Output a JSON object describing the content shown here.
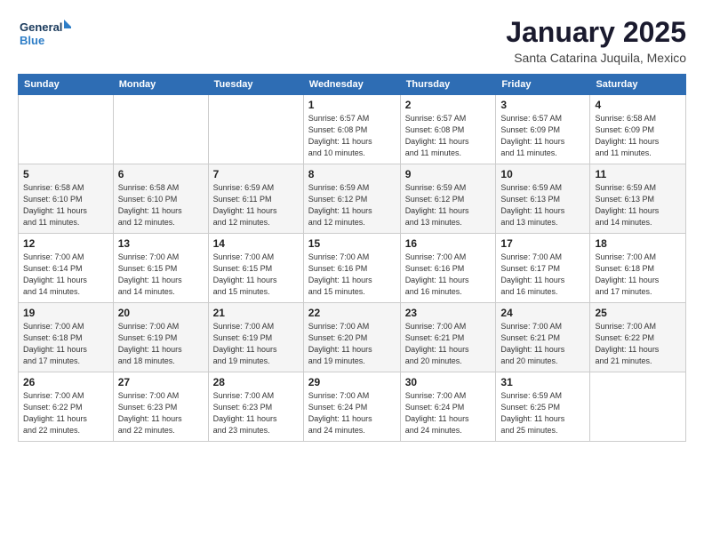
{
  "logo": {
    "line1": "General",
    "line2": "Blue"
  },
  "header": {
    "month": "January 2025",
    "location": "Santa Catarina Juquila, Mexico"
  },
  "weekdays": [
    "Sunday",
    "Monday",
    "Tuesday",
    "Wednesday",
    "Thursday",
    "Friday",
    "Saturday"
  ],
  "weeks": [
    [
      {
        "day": "",
        "info": ""
      },
      {
        "day": "",
        "info": ""
      },
      {
        "day": "",
        "info": ""
      },
      {
        "day": "1",
        "info": "Sunrise: 6:57 AM\nSunset: 6:08 PM\nDaylight: 11 hours\nand 10 minutes."
      },
      {
        "day": "2",
        "info": "Sunrise: 6:57 AM\nSunset: 6:08 PM\nDaylight: 11 hours\nand 11 minutes."
      },
      {
        "day": "3",
        "info": "Sunrise: 6:57 AM\nSunset: 6:09 PM\nDaylight: 11 hours\nand 11 minutes."
      },
      {
        "day": "4",
        "info": "Sunrise: 6:58 AM\nSunset: 6:09 PM\nDaylight: 11 hours\nand 11 minutes."
      }
    ],
    [
      {
        "day": "5",
        "info": "Sunrise: 6:58 AM\nSunset: 6:10 PM\nDaylight: 11 hours\nand 11 minutes."
      },
      {
        "day": "6",
        "info": "Sunrise: 6:58 AM\nSunset: 6:10 PM\nDaylight: 11 hours\nand 12 minutes."
      },
      {
        "day": "7",
        "info": "Sunrise: 6:59 AM\nSunset: 6:11 PM\nDaylight: 11 hours\nand 12 minutes."
      },
      {
        "day": "8",
        "info": "Sunrise: 6:59 AM\nSunset: 6:12 PM\nDaylight: 11 hours\nand 12 minutes."
      },
      {
        "day": "9",
        "info": "Sunrise: 6:59 AM\nSunset: 6:12 PM\nDaylight: 11 hours\nand 13 minutes."
      },
      {
        "day": "10",
        "info": "Sunrise: 6:59 AM\nSunset: 6:13 PM\nDaylight: 11 hours\nand 13 minutes."
      },
      {
        "day": "11",
        "info": "Sunrise: 6:59 AM\nSunset: 6:13 PM\nDaylight: 11 hours\nand 14 minutes."
      }
    ],
    [
      {
        "day": "12",
        "info": "Sunrise: 7:00 AM\nSunset: 6:14 PM\nDaylight: 11 hours\nand 14 minutes."
      },
      {
        "day": "13",
        "info": "Sunrise: 7:00 AM\nSunset: 6:15 PM\nDaylight: 11 hours\nand 14 minutes."
      },
      {
        "day": "14",
        "info": "Sunrise: 7:00 AM\nSunset: 6:15 PM\nDaylight: 11 hours\nand 15 minutes."
      },
      {
        "day": "15",
        "info": "Sunrise: 7:00 AM\nSunset: 6:16 PM\nDaylight: 11 hours\nand 15 minutes."
      },
      {
        "day": "16",
        "info": "Sunrise: 7:00 AM\nSunset: 6:16 PM\nDaylight: 11 hours\nand 16 minutes."
      },
      {
        "day": "17",
        "info": "Sunrise: 7:00 AM\nSunset: 6:17 PM\nDaylight: 11 hours\nand 16 minutes."
      },
      {
        "day": "18",
        "info": "Sunrise: 7:00 AM\nSunset: 6:18 PM\nDaylight: 11 hours\nand 17 minutes."
      }
    ],
    [
      {
        "day": "19",
        "info": "Sunrise: 7:00 AM\nSunset: 6:18 PM\nDaylight: 11 hours\nand 17 minutes."
      },
      {
        "day": "20",
        "info": "Sunrise: 7:00 AM\nSunset: 6:19 PM\nDaylight: 11 hours\nand 18 minutes."
      },
      {
        "day": "21",
        "info": "Sunrise: 7:00 AM\nSunset: 6:19 PM\nDaylight: 11 hours\nand 19 minutes."
      },
      {
        "day": "22",
        "info": "Sunrise: 7:00 AM\nSunset: 6:20 PM\nDaylight: 11 hours\nand 19 minutes."
      },
      {
        "day": "23",
        "info": "Sunrise: 7:00 AM\nSunset: 6:21 PM\nDaylight: 11 hours\nand 20 minutes."
      },
      {
        "day": "24",
        "info": "Sunrise: 7:00 AM\nSunset: 6:21 PM\nDaylight: 11 hours\nand 20 minutes."
      },
      {
        "day": "25",
        "info": "Sunrise: 7:00 AM\nSunset: 6:22 PM\nDaylight: 11 hours\nand 21 minutes."
      }
    ],
    [
      {
        "day": "26",
        "info": "Sunrise: 7:00 AM\nSunset: 6:22 PM\nDaylight: 11 hours\nand 22 minutes."
      },
      {
        "day": "27",
        "info": "Sunrise: 7:00 AM\nSunset: 6:23 PM\nDaylight: 11 hours\nand 22 minutes."
      },
      {
        "day": "28",
        "info": "Sunrise: 7:00 AM\nSunset: 6:23 PM\nDaylight: 11 hours\nand 23 minutes."
      },
      {
        "day": "29",
        "info": "Sunrise: 7:00 AM\nSunset: 6:24 PM\nDaylight: 11 hours\nand 24 minutes."
      },
      {
        "day": "30",
        "info": "Sunrise: 7:00 AM\nSunset: 6:24 PM\nDaylight: 11 hours\nand 24 minutes."
      },
      {
        "day": "31",
        "info": "Sunrise: 6:59 AM\nSunset: 6:25 PM\nDaylight: 11 hours\nand 25 minutes."
      },
      {
        "day": "",
        "info": ""
      }
    ]
  ]
}
